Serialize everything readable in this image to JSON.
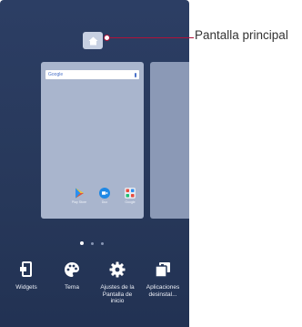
{
  "callout": {
    "label": "Pantalla principal"
  },
  "home_page": {
    "search": {
      "logo_text": "Google"
    },
    "apps": [
      {
        "label": "Play Store",
        "icon": "play-store-icon"
      },
      {
        "label": "Duo",
        "icon": "duo-icon"
      },
      {
        "label": "Google",
        "icon": "google-folder-icon"
      }
    ]
  },
  "page_indicator": {
    "count": 3,
    "active": 0
  },
  "tray": {
    "items": [
      {
        "label": "Widgets",
        "icon": "widgets-icon"
      },
      {
        "label": "Tema",
        "icon": "palette-icon"
      },
      {
        "label": "Ajustes de la\nPantalla de\ninicio",
        "icon": "gear-icon"
      },
      {
        "label": "Aplicaciones\ndesinstal...",
        "icon": "uninstalled-apps-icon"
      }
    ]
  },
  "colors": {
    "background": "#27385a",
    "callout_accent": "#b0123a",
    "card": "#a9b5cd"
  }
}
